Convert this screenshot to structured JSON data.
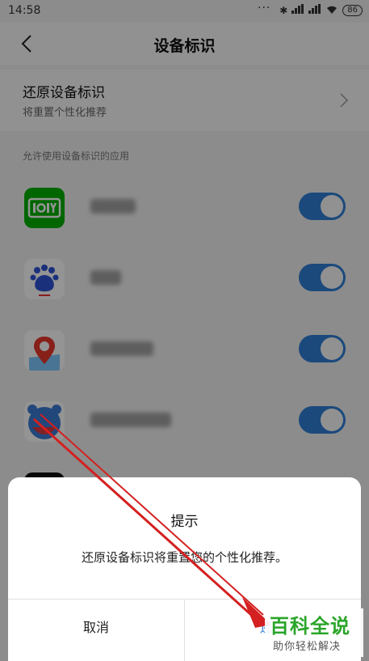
{
  "status_bar": {
    "time": "14:58",
    "battery": "86"
  },
  "navbar": {
    "title": "设备标识"
  },
  "reset": {
    "title": "还原设备标识",
    "subtitle": "将重置个性化推荐"
  },
  "section": {
    "label": "允许使用设备标识的应用"
  },
  "apps": [
    {
      "icon": "iqiyi-icon",
      "enabled": true
    },
    {
      "icon": "baidu-icon",
      "enabled": true
    },
    {
      "icon": "baidu-map-icon",
      "enabled": true
    },
    {
      "icon": "baidu-input-icon",
      "enabled": true
    }
  ],
  "dialog": {
    "title": "提示",
    "message": "还原设备标识将重置您的个性化推荐。",
    "cancel_label": "取消",
    "confirm_label": "还原"
  },
  "watermark": {
    "brand": "百科全说",
    "tagline": "助你轻松解决"
  },
  "colors": {
    "accent": "#2f7fd6",
    "annotation_arrow": "#d42020",
    "watermark_green": "#2aa52a"
  }
}
